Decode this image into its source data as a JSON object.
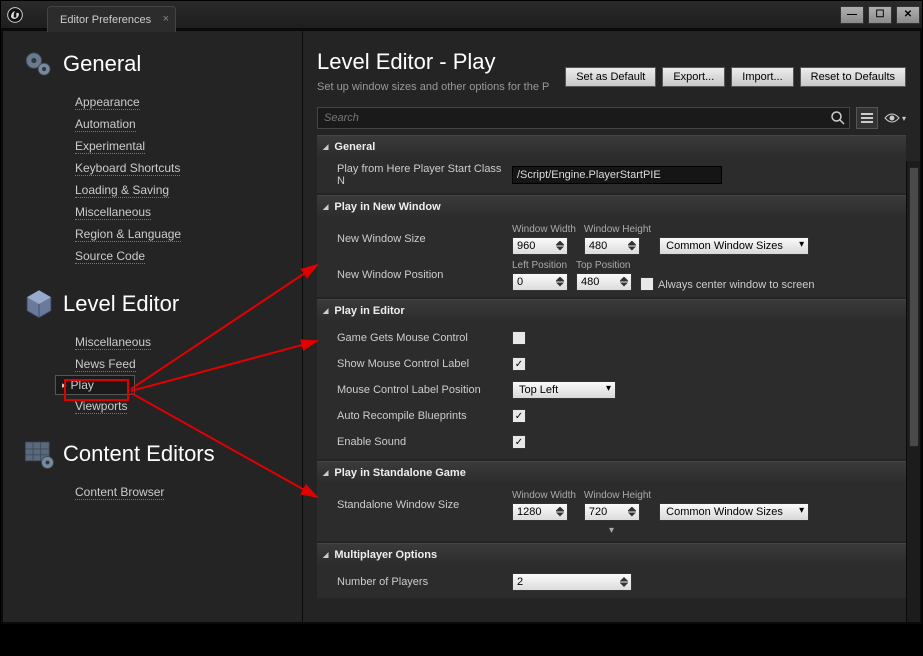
{
  "window": {
    "tab_title": "Editor Preferences"
  },
  "sidebar": {
    "groups": [
      {
        "title": "General",
        "items": [
          "Appearance",
          "Automation",
          "Experimental",
          "Keyboard Shortcuts",
          "Loading & Saving",
          "Miscellaneous",
          "Region & Language",
          "Source Code"
        ]
      },
      {
        "title": "Level Editor",
        "items": [
          "Miscellaneous",
          "News Feed",
          "Play",
          "Viewports"
        ],
        "active_index": 2
      },
      {
        "title": "Content Editors",
        "items": [
          "Content Browser"
        ]
      }
    ]
  },
  "main": {
    "title": "Level Editor - Play",
    "subtitle": "Set up window sizes and other options for the P",
    "buttons": {
      "set_default": "Set as Default",
      "export": "Export...",
      "import": "Import...",
      "reset": "Reset to Defaults"
    },
    "search_placeholder": "Search"
  },
  "sections": {
    "general": {
      "title": "General",
      "play_from_here_label": "Play from Here Player Start Class N",
      "play_from_here_value": "/Script/Engine.PlayerStartPIE"
    },
    "new_window": {
      "title": "Play in New Window",
      "size_label": "New Window Size",
      "pos_label": "New Window Position",
      "width_label": "Window Width",
      "width_value": "960",
      "height_label": "Window Height",
      "height_value": "480",
      "left_label": "Left Position",
      "left_value": "0",
      "top_label": "Top Position",
      "top_value": "480",
      "common_sizes": "Common Window Sizes",
      "always_center": "Always center window to screen"
    },
    "editor": {
      "title": "Play in Editor",
      "mouse_control_label": "Game Gets Mouse Control",
      "mouse_control_checked": false,
      "show_label_label": "Show Mouse Control Label",
      "show_label_checked": true,
      "label_pos_label": "Mouse Control Label Position",
      "label_pos_value": "Top Left",
      "auto_recompile_label": "Auto Recompile Blueprints",
      "auto_recompile_checked": true,
      "enable_sound_label": "Enable Sound",
      "enable_sound_checked": true
    },
    "standalone": {
      "title": "Play in Standalone Game",
      "size_label": "Standalone Window Size",
      "width_label": "Window Width",
      "width_value": "1280",
      "height_label": "Window Height",
      "height_value": "720",
      "common_sizes": "Common Window Sizes"
    },
    "multiplayer": {
      "title": "Multiplayer Options",
      "players_label": "Number of Players",
      "players_value": "2"
    }
  }
}
